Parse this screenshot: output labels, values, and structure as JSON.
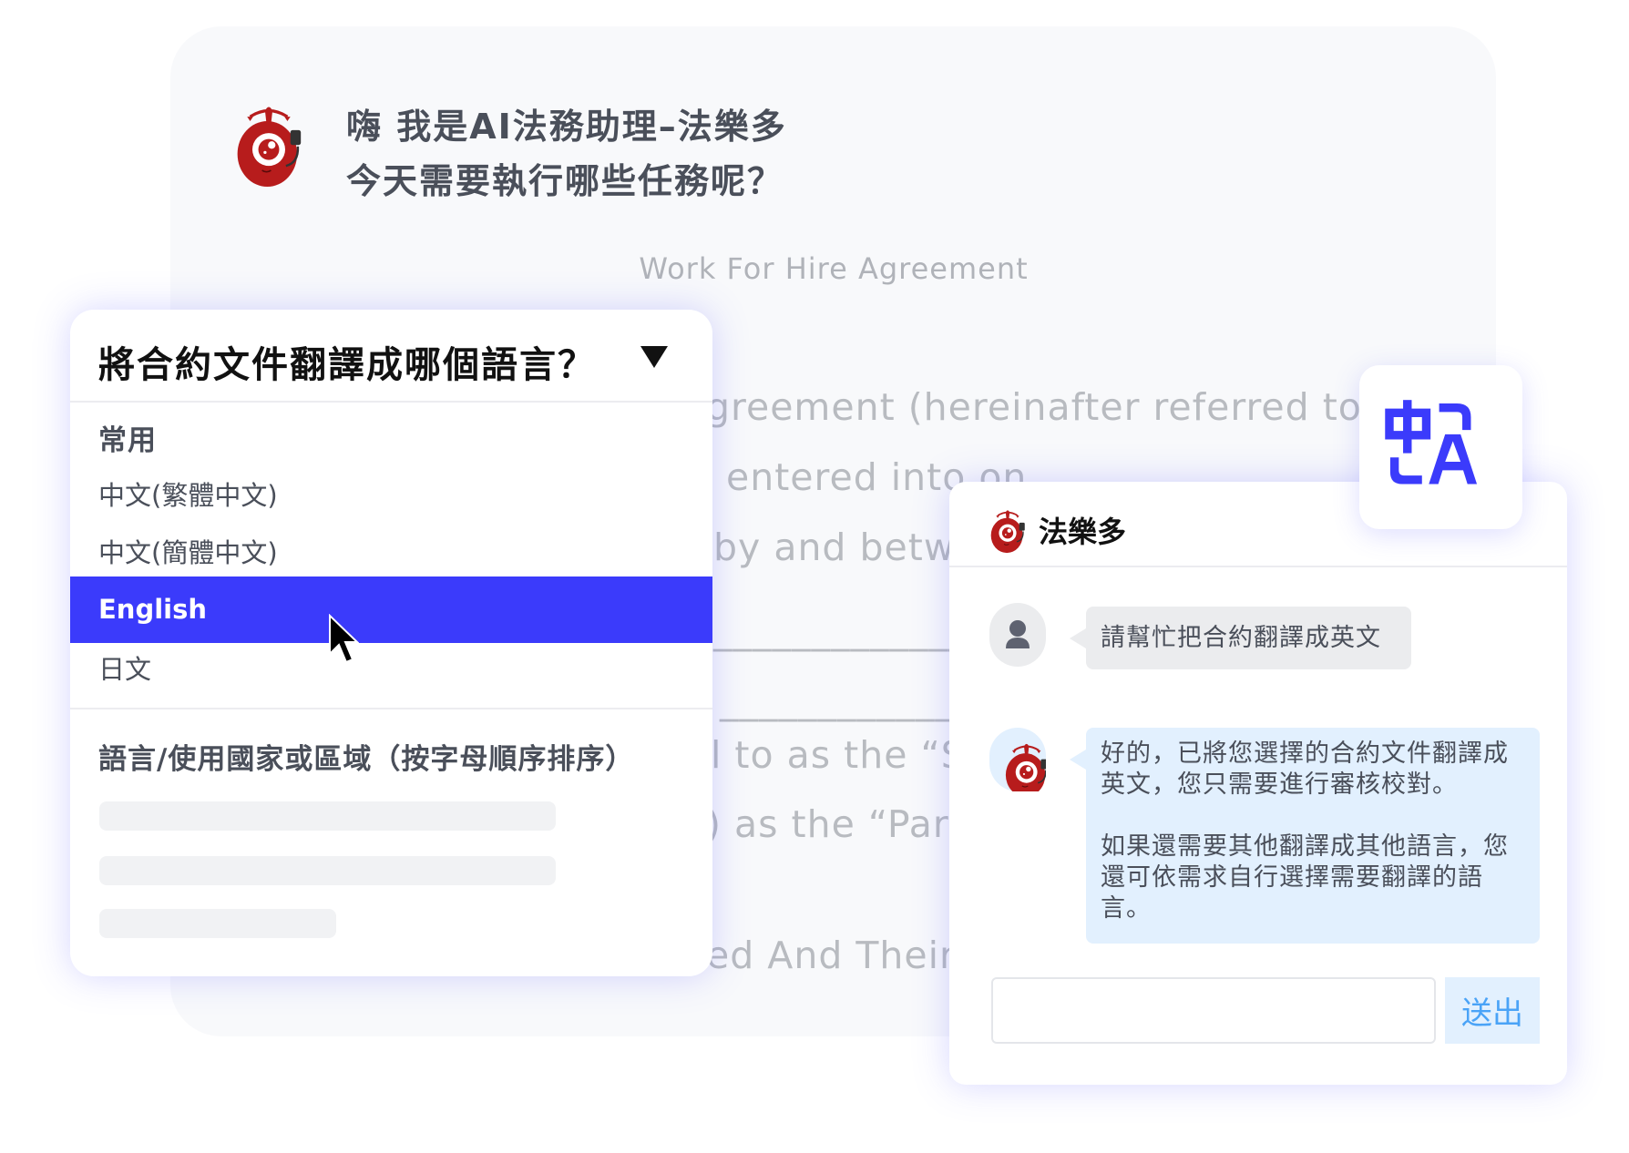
{
  "colors": {
    "accent": "#3b3bfb",
    "mascot_red": "#b71c1c",
    "send_text": "#4aa3f7",
    "bot_bubble": "#e2f0fe",
    "user_bubble": "#ebecee"
  },
  "greeting": {
    "line1": "嗨  我是AI法務助理–法樂多",
    "line2": "今天需要執行哪些任務呢？"
  },
  "document": {
    "title": "Work For Hire Agreement",
    "lines": [
      "greement (hereinafter referred to",
      "entered into on",
      "by and betw",
      "______________",
      "______________",
      "l to as the “S",
      ") as the “Part",
      "ed And Their"
    ]
  },
  "dropdown": {
    "title": "將合約文件翻譯成哪個語言？",
    "caret_icon": "triangle-down-icon",
    "common_heading": "常用",
    "items": [
      {
        "label": "中文(繁體中文)",
        "selected": false
      },
      {
        "label": "中文(簡體中文)",
        "selected": false
      },
      {
        "label": "English",
        "selected": true
      },
      {
        "label": "日文",
        "selected": false
      }
    ],
    "all_heading": "語言/使用國家或區域（按字母順序排序）"
  },
  "chat": {
    "title": "法樂多",
    "messages": [
      {
        "role": "user",
        "avatar_icon": "user-icon",
        "text": "請幫忙把合約翻譯成英文"
      },
      {
        "role": "bot",
        "avatar_icon": "mascot-icon",
        "paragraphs": [
          "好的，已將您選擇的合約文件翻譯成英文，您只需要進行審核校對。",
          "如果還需要其他翻譯成其他語言，您還可依需求自行選擇需要翻譯的語言。"
        ]
      }
    ],
    "input_value": "",
    "send_label": "送出"
  },
  "translate_icon": "translate-icon"
}
